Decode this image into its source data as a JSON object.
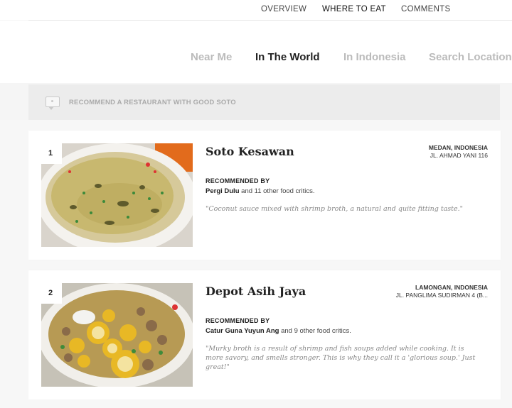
{
  "top_nav": {
    "items": [
      {
        "label": "OVERVIEW",
        "active": false
      },
      {
        "label": "WHERE TO EAT",
        "active": true
      },
      {
        "label": "COMMENTS",
        "active": false
      }
    ],
    "accent_color": "#d9483b"
  },
  "location_tabs": {
    "items": [
      {
        "label": "Near Me",
        "active": false
      },
      {
        "label": "In The World",
        "active": true
      },
      {
        "label": "In Indonesia",
        "active": false
      },
      {
        "label": "Search Location",
        "active": false
      }
    ]
  },
  "recommend_bar": {
    "label": "RECOMMEND A RESTAURANT WITH GOOD SOTO",
    "icon": "chat-bubble-icon"
  },
  "restaurants": [
    {
      "rank": "1",
      "name": "Soto Kesawan",
      "city": "MEDAN, INDONESIA",
      "street": "JL. AHMAD YANI 116",
      "recommended_by_label": "RECOMMENDED BY",
      "critic": "Pergi Dulu",
      "critics_suffix": " and 11 other food critics.",
      "quote": "\"Coconut sauce mixed with shrimp broth, a natural and quite fitting taste.\"",
      "photo": "soto-kesawan-bowl-image"
    },
    {
      "rank": "2",
      "name": "Depot Asih Jaya",
      "city": "LAMONGAN, INDONESIA",
      "street": "JL. PANGLIMA SUDIRMAN 4 (B...",
      "recommended_by_label": "RECOMMENDED BY",
      "critic": "Catur Guna Yuyun Ang",
      "critics_suffix": " and 9 other food critics.",
      "quote": "\"Murky broth is a result of shrimp and fish soups added while cooking. It is more savory, and smells stronger. This is why they call it a 'glorious soup.' Just great!\"",
      "photo": "depot-asih-jaya-bowl-image"
    }
  ]
}
